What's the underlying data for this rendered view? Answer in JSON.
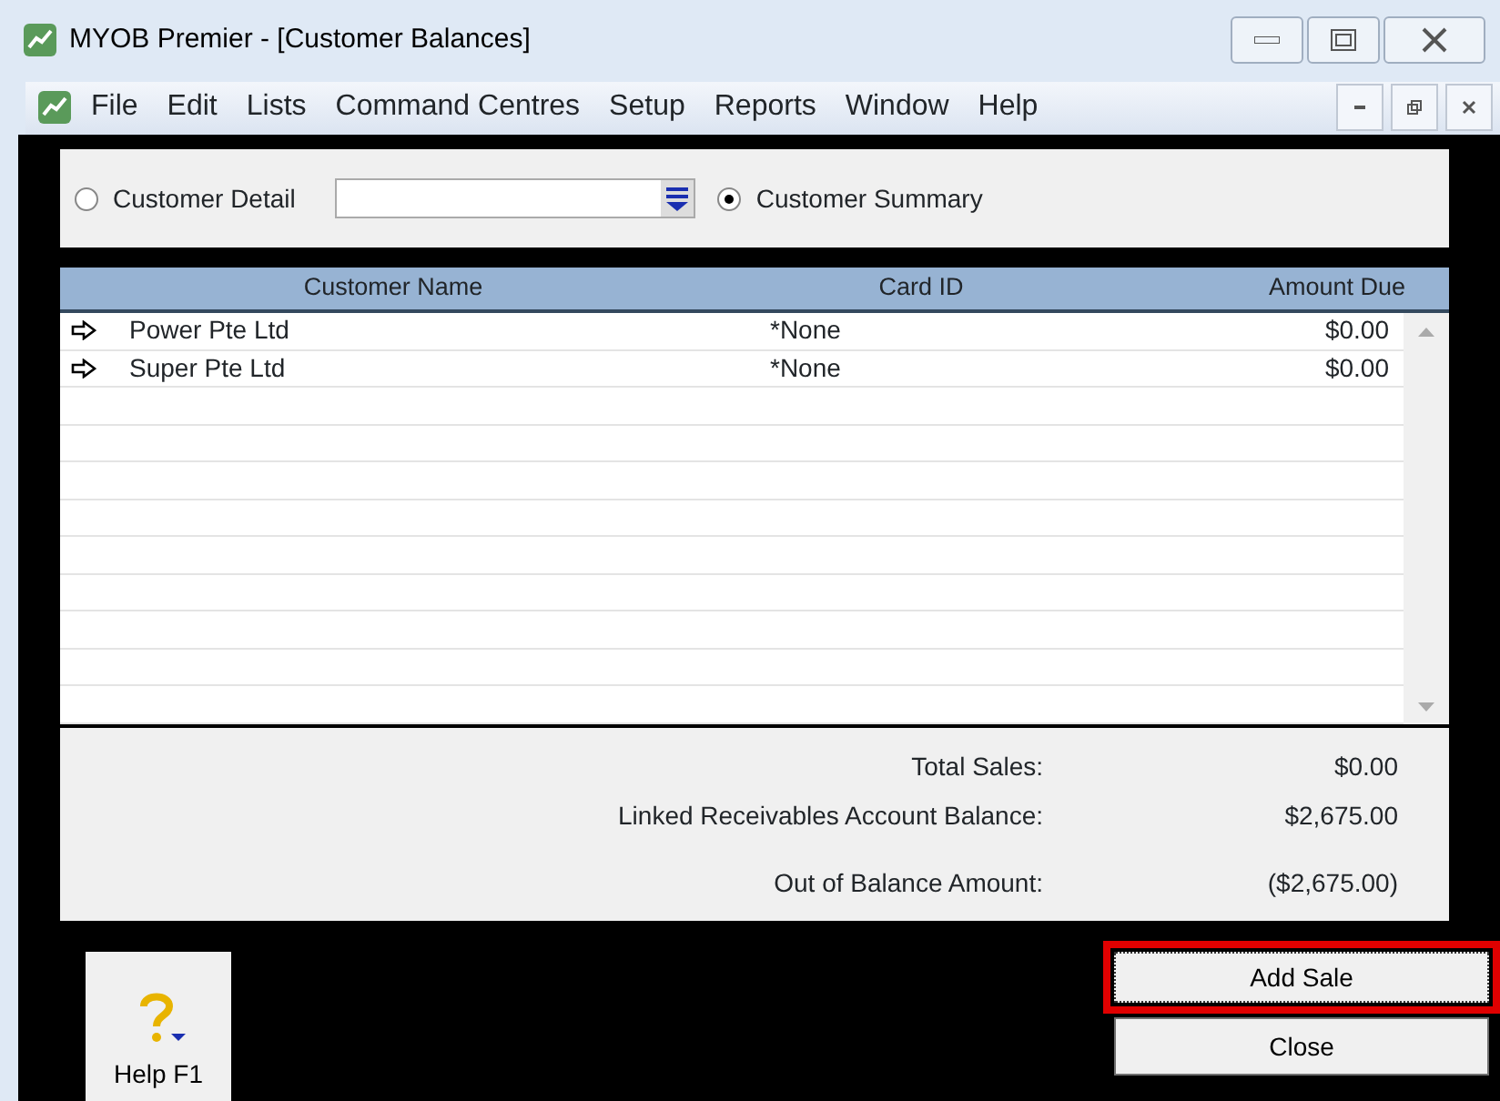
{
  "window": {
    "title": "MYOB Premier - [Customer Balances]"
  },
  "menu": [
    "File",
    "Edit",
    "Lists",
    "Command Centres",
    "Setup",
    "Reports",
    "Window",
    "Help"
  ],
  "view_options": [
    {
      "label": "Customer Detail",
      "selected": false,
      "kind": "radio-with-combo"
    },
    {
      "label": "Customer Summary",
      "selected": true,
      "kind": "radio"
    }
  ],
  "table": {
    "columns": [
      "Customer Name",
      "Card ID",
      "Amount Due"
    ],
    "rows": [
      [
        "Power Pte Ltd",
        "*None",
        "$0.00"
      ],
      [
        "Super Pte Ltd",
        "*None",
        "$0.00"
      ]
    ]
  },
  "totals": [
    {
      "label": "Total Sales:",
      "value": "$0.00"
    },
    {
      "label": "Linked Receivables Account Balance:",
      "value": "$2,675.00"
    },
    {
      "label": "Out of Balance Amount:",
      "value": "($2,675.00)"
    }
  ],
  "help_button": {
    "label": "Help F1"
  },
  "buttons": [
    {
      "label": "Add Sale",
      "highlighted": true
    },
    {
      "label": "Close",
      "highlighted": false
    }
  ]
}
